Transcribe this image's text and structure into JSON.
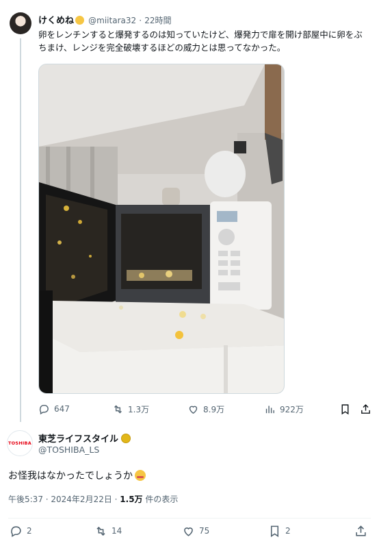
{
  "tweet": {
    "display_name": "けくめね",
    "handle": "@miitara32",
    "separator": "·",
    "time_ago": "22時間",
    "text": "卵をレンチンすると爆発するのは知っていたけど、爆発力で扉を開け部屋中に卵をぶちまけ、レンジを完全破壊するほどの威力とは思ってなかった。",
    "image_alt": "microwave-after-egg-explosion-photo",
    "stats": {
      "replies": "647",
      "retweets": "1.3万",
      "likes": "8.9万",
      "views": "922万"
    }
  },
  "reply": {
    "avatar_text": "TOSHIBA",
    "display_name": "東芝ライフスタイル",
    "handle": "@TOSHIBA_LS",
    "text": "お怪我はなかったでしょうか",
    "timestamp": "午後5:37 · 2024年2月22日 · ",
    "views_count": "1.5万",
    "views_label": " 件の表示",
    "stats": {
      "replies": "2",
      "retweets": "14",
      "likes": "75",
      "bookmarks": "2"
    }
  },
  "colors": {
    "text_primary": "#0f1419",
    "text_secondary": "#536471",
    "border": "#cfd9de",
    "verified_gold": "#e2b719",
    "brand_red": "#e60012"
  },
  "icons": [
    "reply-icon",
    "retweet-icon",
    "like-icon",
    "views-icon",
    "bookmark-icon",
    "share-icon",
    "verified-badge-icon"
  ]
}
